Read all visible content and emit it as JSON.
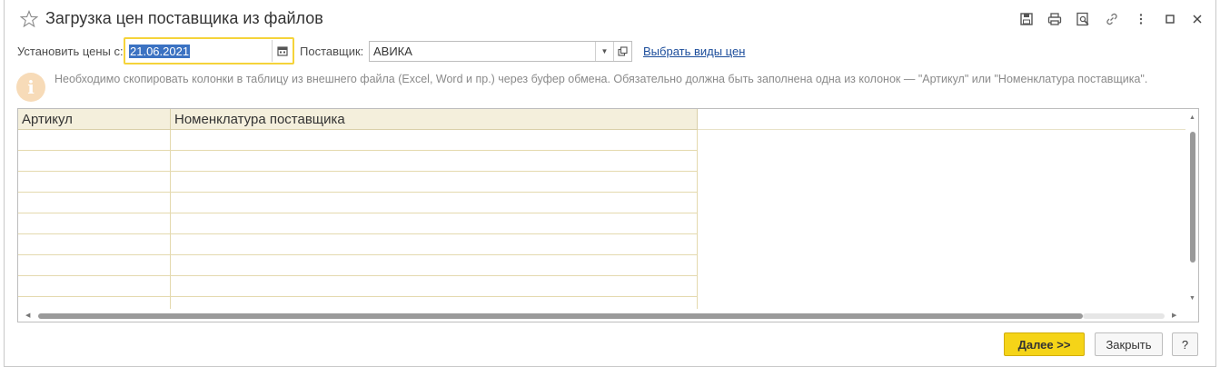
{
  "window": {
    "title": "Загрузка цен поставщика из файлов",
    "icons": [
      "star-icon",
      "save-icon",
      "print-icon",
      "preview-icon",
      "link-icon",
      "more-icon",
      "maximize-icon",
      "close-icon"
    ]
  },
  "filters": {
    "date_label": "Установить цены с:",
    "date_value": "21.06.2021",
    "supplier_label": "Поставщик:",
    "supplier_value": "АВИКА",
    "price_types_link": "Выбрать виды цен"
  },
  "info": {
    "text": "Необходимо скопировать колонки в таблицу из внешнего файла (Excel, Word и пр.) через буфер обмена. Обязательно должна быть заполнена одна из колонок — \"Артикул\" или \"Номенклатура поставщика\"."
  },
  "table": {
    "columns": [
      "Артикул",
      "Номенклатура поставщика"
    ],
    "rows": 9
  },
  "buttons": {
    "next": "Далее >>",
    "close": "Закрыть",
    "help": "?"
  },
  "colors": {
    "accent": "#f5d418",
    "link": "#1c4d9b",
    "header_bg": "#f4efdc",
    "selection": "#3b72c2"
  }
}
